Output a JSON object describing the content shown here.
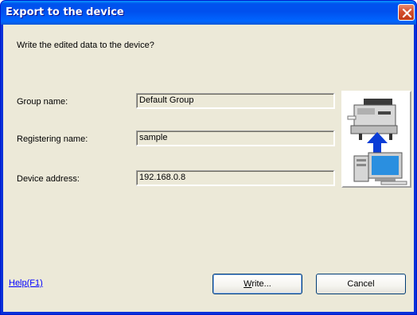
{
  "window": {
    "title": "Export to the device"
  },
  "dialog": {
    "prompt": "Write the edited data to the device?",
    "fields": [
      {
        "label": "Group name:",
        "value": "Default Group"
      },
      {
        "label": "Registering name:",
        "value": "sample"
      },
      {
        "label": "Device address:",
        "value": "192.168.0.8"
      }
    ]
  },
  "footer": {
    "help_label": "Help(F1)",
    "write_label_mnemonic": "W",
    "write_label_rest": "rite...",
    "cancel_label": "Cancel"
  },
  "icons": {
    "close": "close-icon",
    "illustration": "printer-upload-from-pc-icon"
  },
  "colors": {
    "titlebar": "#0054e3",
    "dialog_background": "#ece9d8",
    "link": "#0000ff"
  }
}
